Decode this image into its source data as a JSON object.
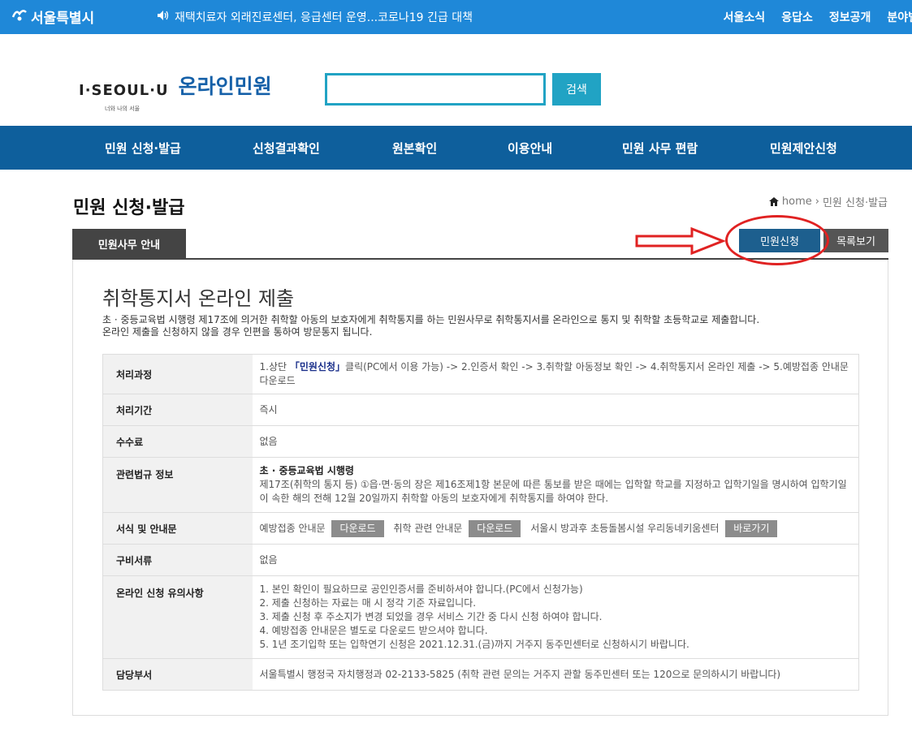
{
  "topbar": {
    "logo": "서울특별시",
    "notice": "재택치료자 외래진료센터, 응급센터 운영...코로나19 긴급 대책",
    "links": [
      "서울소식",
      "응답소",
      "정보공개",
      "분야별"
    ]
  },
  "header": {
    "brand_mark": "I·SEOUL·U",
    "brand_sub": "너와 나의 서울",
    "title": "온라인민원",
    "search_value": "",
    "search_button": "검색"
  },
  "nav": [
    "민원 신청·발급",
    "신청결과확인",
    "원본확인",
    "이용안내",
    "민원 사무 편람",
    "민원제안신청"
  ],
  "page": {
    "title": "민원 신청·발급",
    "breadcrumb": [
      "home",
      "민원 신청·발급"
    ],
    "tab": "민원사무 안내",
    "apply_button": "민원신청",
    "list_button": "목록보기"
  },
  "content": {
    "heading": "취학통지서 온라인 제출",
    "desc_line1": "초 · 중등교육법 시행령 제17조에 의거한 취학할 아동의 보호자에게 취학통지를 하는 민원사무로 취학통지서를 온라인으로 통지 및 취학할 초등학교로 제출합니다.",
    "desc_line2": "온라인 제출을 신청하지 않을 경우 인편을 통하여 방문통지 됩니다.",
    "rows": {
      "process": {
        "label": "처리과정",
        "pre": "1.상단 ",
        "highlight": "「민원신청」",
        "post": "클릭(PC에서 이용 가능) -> 2.인증서 확인 -> 3.취학할 아동정보 확인 -> 4.취학통지서 온라인 제출 -> 5.예방접종 안내문 다운로드"
      },
      "period": {
        "label": "처리기간",
        "value": "즉시"
      },
      "fee": {
        "label": "수수료",
        "value": "없음"
      },
      "law": {
        "label": "관련법규 정보",
        "title": "초 · 중등교육법 시행령",
        "text": "제17조(취학의 통지 등) ①읍·면·동의 장은 제16조제1항 본문에 따른 통보를 받은 때에는 입학할 학교를 지정하고 입학기일을 명시하여 입학기일이 속한 해의 전해 12월 20일까지 취학할 아동의 보호자에게 취학통지를 하여야 한다."
      },
      "forms": {
        "label": "서식 및 안내문",
        "item1": "예방접종 안내문",
        "btn1": "다운로드",
        "item2": "취학 관련 안내문",
        "btn2": "다운로드",
        "item3": "서울시 방과후 초등돌봄시설 우리동네키움센터",
        "btn3": "바로가기"
      },
      "docs": {
        "label": "구비서류",
        "value": "없음"
      },
      "notes": {
        "label": "온라인 신청 유의사항",
        "items": [
          "1. 본인 확인이 필요하므로 공인인증서를 준비하셔야 합니다.(PC에서 신청가능)",
          "2. 제출 신청하는 자료는 매 시 정각 기준 자료입니다.",
          "3. 제출 신청 후 주소지가 변경 되었을 경우 서비스 기간 중 다시 신청 하여야 합니다.",
          "4. 예방접종 안내문은 별도로 다운로드 받으셔야 합니다.",
          "5. 1년 조기입학 또는 입학연기 신청은 2021.12.31.(금)까지 거주지 동주민센터로 신청하시기 바랍니다."
        ]
      },
      "dept": {
        "label": "담당부서",
        "value": "서울특별시 행정국 자치행정과 02-2133-5825 (취학 관련 문의는 거주지 관할 동주민센터 또는 120으로 문의하시기 바랍니다)"
      }
    }
  },
  "colors": {
    "topbar": "#1f88d8",
    "nav": "#0e5f9c",
    "search_accent": "#21a3c4",
    "apply_button": "#1d5f8e",
    "annotation": "#e02222"
  }
}
